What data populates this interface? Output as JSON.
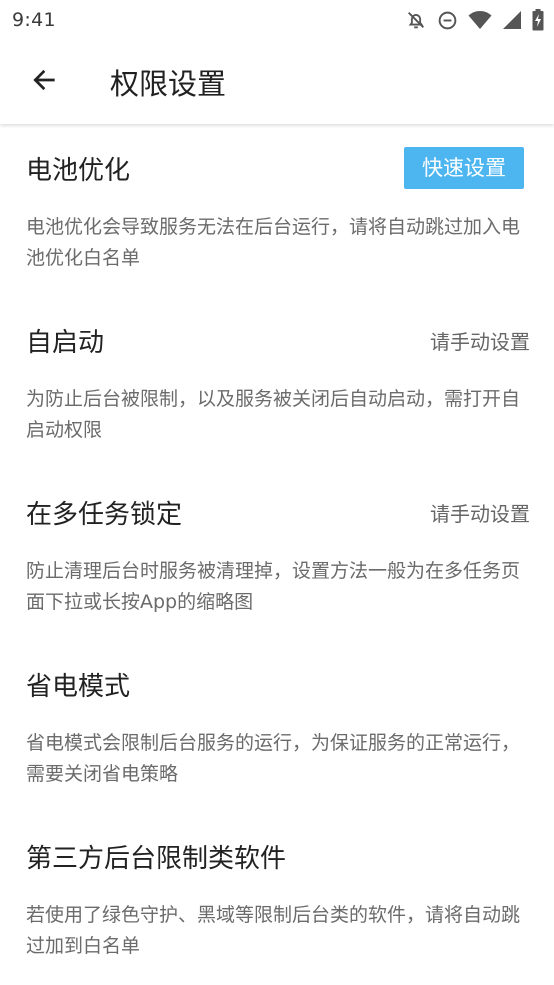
{
  "status_bar": {
    "time": "9:41",
    "icons": [
      "notifications-off-icon",
      "do-not-disturb-icon",
      "wifi-icon",
      "cellular-signal-icon",
      "battery-charging-icon"
    ]
  },
  "app_bar": {
    "back_icon": "arrow-back-icon",
    "title": "权限设置"
  },
  "sections": [
    {
      "title": "电池优化",
      "action": "快速设置",
      "action_type": "button",
      "description": "电池优化会导致服务无法在后台运行，请将自动跳过加入电池优化白名单"
    },
    {
      "title": "自启动",
      "action": "请手动设置",
      "action_type": "link",
      "description": "为防止后台被限制，以及服务被关闭后自动启动，需打开自启动权限"
    },
    {
      "title": "在多任务锁定",
      "action": "请手动设置",
      "action_type": "link",
      "description": "防止清理后台时服务被清理掉，设置方法一般为在多任务页面下拉或长按App的缩略图"
    },
    {
      "title": "省电模式",
      "description": "省电模式会限制后台服务的运行，为保证服务的正常运行，需要关闭省电策略"
    },
    {
      "title": "第三方后台限制类软件",
      "description": "若使用了绿色守护、黑域等限制后台类的软件，请将自动跳过加到白名单"
    }
  ],
  "colors": {
    "accent_button": "#4db6f0",
    "title_text": "#212121",
    "secondary_text": "#6b6b6b"
  }
}
